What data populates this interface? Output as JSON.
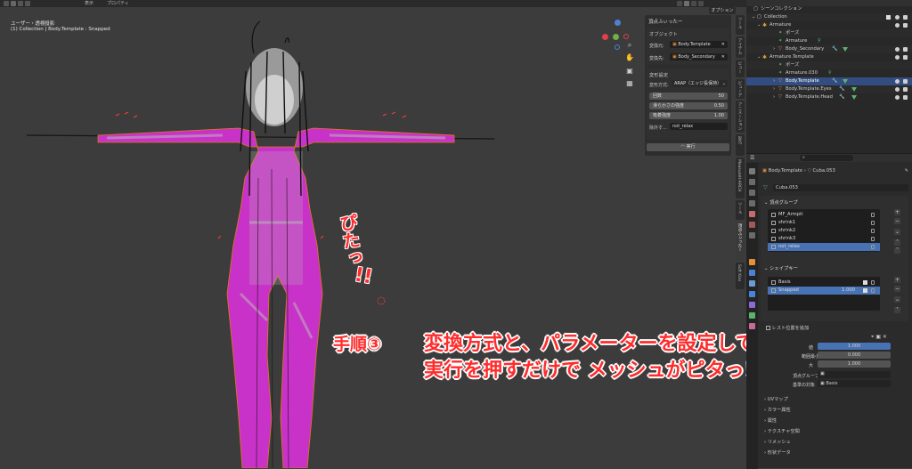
{
  "viewport": {
    "topbar_fragments": [
      "プロパティ",
      "オプション",
      "表示"
    ],
    "info_line1": "ユーザー・透視投影",
    "info_line2": "(1) Collection | Body.Template : Snapped",
    "options_button": "オプション",
    "axis_colors": {
      "x": "#e0404a",
      "y": "#6fb142",
      "z": "#4a82d6"
    }
  },
  "npanel": {
    "title": "頂点ふぃったー",
    "objects_header": "オブジェクト",
    "source_label": "変換元:",
    "source_value": "Body.Template",
    "dest_label": "変換先:",
    "dest_value": "Body_Secondary",
    "deform_header": "変形設定",
    "method_label": "変形方式:",
    "method_value": "ARAP（エッジ長保持）",
    "iterations_label": "回数",
    "iterations_value": "50",
    "smooth_label": "滑らかさの強度",
    "smooth_value": "0.50",
    "suction_label": "吸着強度",
    "suction_value": "1.00",
    "exclude_label": "除外す...",
    "exclude_value": "not_relax",
    "run_label": "実行"
  },
  "side_tabs": [
    "ツール",
    "アイテム",
    "ビュー",
    "ビューア",
    "アニメーション",
    "BNT",
    "MeasureIt-ARCH",
    "ツール",
    "頂点ふぃったー",
    "Soft Kiss"
  ],
  "outliner": {
    "header": "シーンコレクション",
    "rows": [
      {
        "label": "Collection",
        "indent": 0,
        "kind": "collection"
      },
      {
        "label": "Armature",
        "indent": 1,
        "kind": "armature"
      },
      {
        "label": "ポーズ",
        "indent": 2,
        "kind": "pose"
      },
      {
        "label": "Armature",
        "indent": 2,
        "kind": "armature"
      },
      {
        "label": "Body_Secondary",
        "indent": 2,
        "kind": "mesh"
      },
      {
        "label": "Armature.Template",
        "indent": 1,
        "kind": "armature"
      },
      {
        "label": "ポーズ",
        "indent": 2,
        "kind": "pose"
      },
      {
        "label": "Armature.030",
        "indent": 2,
        "kind": "armature"
      },
      {
        "label": "Body.Template",
        "indent": 2,
        "kind": "mesh",
        "selected": true
      },
      {
        "label": "Body.Template.Eyes",
        "indent": 2,
        "kind": "mesh"
      },
      {
        "label": "Body.Template.Head",
        "indent": 2,
        "kind": "mesh"
      }
    ]
  },
  "properties": {
    "breadcrumb_object": "Body.Template",
    "breadcrumb_mesh": "Cuba.053",
    "mesh_name": "Cuba.053",
    "vgroups_header": "頂点グループ",
    "vgroups": [
      "MF_Armpit",
      "shrink1",
      "shrink2",
      "shrink3",
      "not_relax"
    ],
    "vgroup_selected": 4,
    "shapekeys_header": "シェイプキー",
    "shapekeys": [
      {
        "name": "Basis",
        "value": ""
      },
      {
        "name": "Snapped",
        "value": "1.000"
      }
    ],
    "shapekey_selected": 1,
    "relative_label": "レスト位置を追加",
    "value_label": "値",
    "value_value": "1.000",
    "min_label": "範囲最小",
    "min_value": "0.000",
    "max_label": "大",
    "max_value": "1.000",
    "vgroup_field_label": "頂点グループ",
    "relative_key_label": "基準の対象",
    "relative_key_value": "Basis",
    "collapsed_sections": [
      "UVマップ",
      "カラー属性",
      "属性",
      "テクスチャ空間",
      "リメッシュ",
      "形状データ"
    ]
  },
  "annotation": {
    "step": "手順③",
    "line1": "変換方式と、パラメーターを設定して",
    "line2": "実行を押すだけで メッシュがピタっ！",
    "onomatopoeia": "ぴたっ",
    "exclaim": "!!"
  }
}
